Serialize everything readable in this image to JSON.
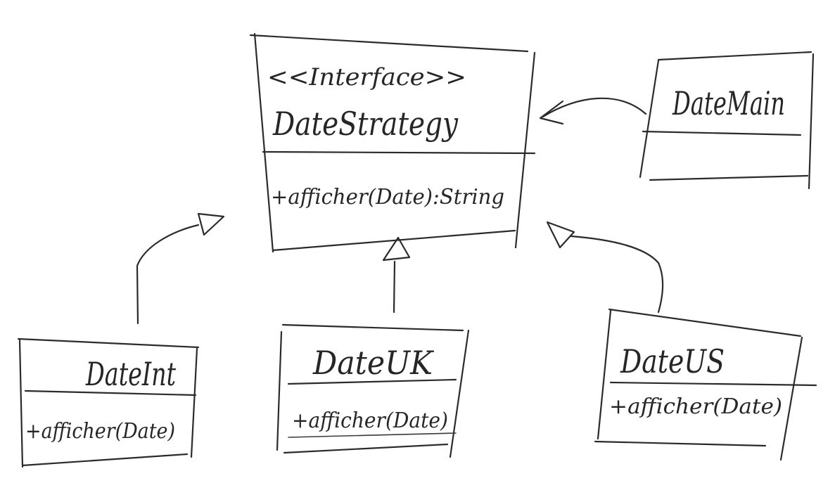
{
  "classes": {
    "strategy": {
      "stereotype": "<<Interface>>",
      "name": "DateStrategy",
      "method": "+afficher(Date):String"
    },
    "main": {
      "name": "DateMain"
    },
    "int": {
      "name": "DateInt",
      "method": "+afficher(Date)"
    },
    "uk": {
      "name": "DateUK",
      "method": "+afficher(Date)"
    },
    "us": {
      "name": "DateUS",
      "method": "+afficher(Date)"
    }
  }
}
